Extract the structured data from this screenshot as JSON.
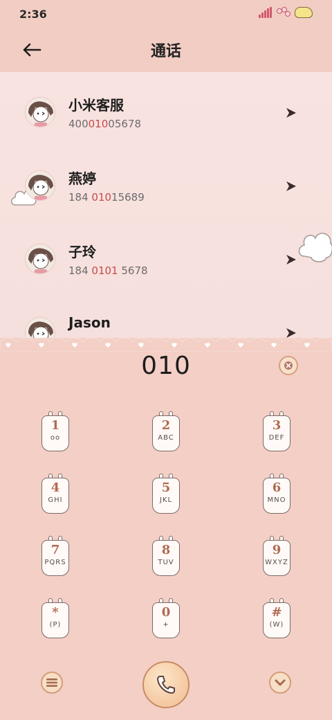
{
  "status_bar": {
    "time": "2:36"
  },
  "header": {
    "title": "通话"
  },
  "contacts": [
    {
      "name": "小米客服",
      "number_parts": [
        "400",
        "010",
        "05678"
      ]
    },
    {
      "name": "燕婷",
      "number_parts": [
        "184 ",
        "010",
        "15689"
      ]
    },
    {
      "name": "子玲",
      "number_parts": [
        "184 ",
        "0101",
        " 5678"
      ]
    },
    {
      "name": "Jason",
      "number_parts": [
        "",
        "",
        ""
      ]
    }
  ],
  "dialer": {
    "number": "010"
  },
  "keypad": [
    {
      "digit": "1",
      "letters": "oo"
    },
    {
      "digit": "2",
      "letters": "ABC"
    },
    {
      "digit": "3",
      "letters": "DEF"
    },
    {
      "digit": "4",
      "letters": "GHI"
    },
    {
      "digit": "5",
      "letters": "JKL"
    },
    {
      "digit": "6",
      "letters": "MNO"
    },
    {
      "digit": "7",
      "letters": "PQRS"
    },
    {
      "digit": "8",
      "letters": "TUV"
    },
    {
      "digit": "9",
      "letters": "WXYZ"
    },
    {
      "digit": "*",
      "letters": "(P)"
    },
    {
      "digit": "0",
      "letters": "+"
    },
    {
      "digit": "#",
      "letters": "(W)"
    }
  ],
  "colors": {
    "header_bg": "#f2cdc3",
    "list_bg": "#f8e3e0",
    "dialer_bg": "#f3cfc6",
    "highlight": "#c94a4a",
    "key_digit": "#b06b52"
  },
  "icons": {
    "back": "arrow-left-icon",
    "row_action": "chevron-right-icon",
    "clear": "close-icon",
    "menu": "menu-icon",
    "call": "phone-icon",
    "collapse": "chevron-down-icon"
  }
}
